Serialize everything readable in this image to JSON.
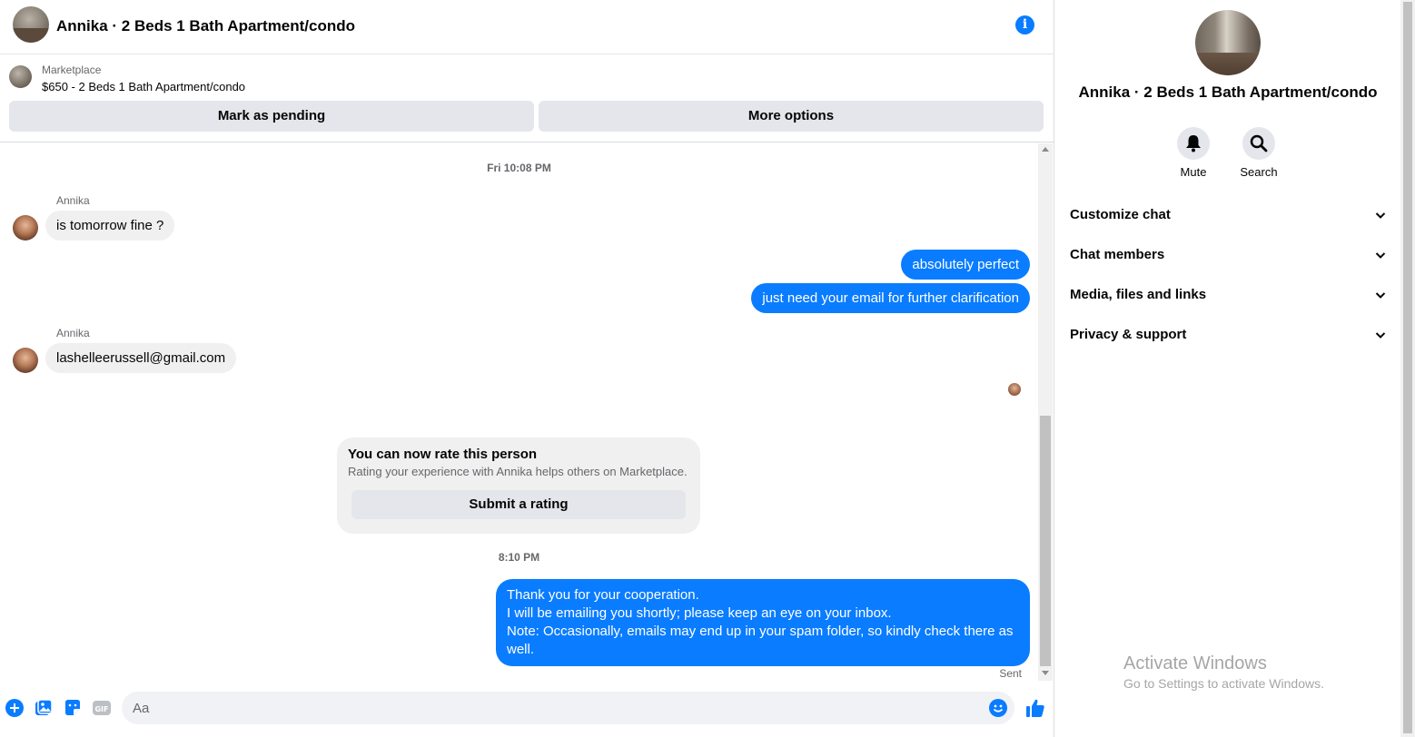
{
  "header": {
    "title": "Annika · 2 Beds 1 Bath Apartment/condo",
    "info_icon": "info-icon"
  },
  "marketplace": {
    "label": "Marketplace",
    "item": "$650 - 2 Beds 1 Bath Apartment/condo",
    "mark_pending": "Mark as pending",
    "more_options": "More options"
  },
  "messages": {
    "time1": "Fri 10:08 PM",
    "sender1": "Annika",
    "msg1": "is tomorrow fine ?",
    "out1": "absolutely perfect",
    "out2": "just need your email for further clarification",
    "sender2": "Annika",
    "msg2": "lashelleerussell@gmail.com",
    "time2": "8:10 PM",
    "out3_line1": "Thank you for your cooperation.",
    "out3_line2": "I will be emailing you shortly; please keep an eye on your inbox.",
    "out3_line3": "Note: Occasionally, emails may end up in your spam folder, so kindly check there as well.",
    "status": "Sent"
  },
  "rating": {
    "title": "You can now rate this person",
    "subtitle": "Rating your experience with Annika helps others on Marketplace.",
    "button": "Submit a rating"
  },
  "composer": {
    "placeholder": "Aa"
  },
  "info_panel": {
    "name": "Annika · 2 Beds 1 Bath Apartment/condo",
    "mute": "Mute",
    "search": "Search",
    "sections": [
      "Customize chat",
      "Chat members",
      "Media, files and links",
      "Privacy & support"
    ]
  },
  "watermark": {
    "line1": "Activate Windows",
    "line2": "Go to Settings to activate Windows."
  },
  "colors": {
    "accent": "#0a7cff",
    "bubble_in": "#f0f0f0",
    "button_gray": "#e4e6eb"
  }
}
